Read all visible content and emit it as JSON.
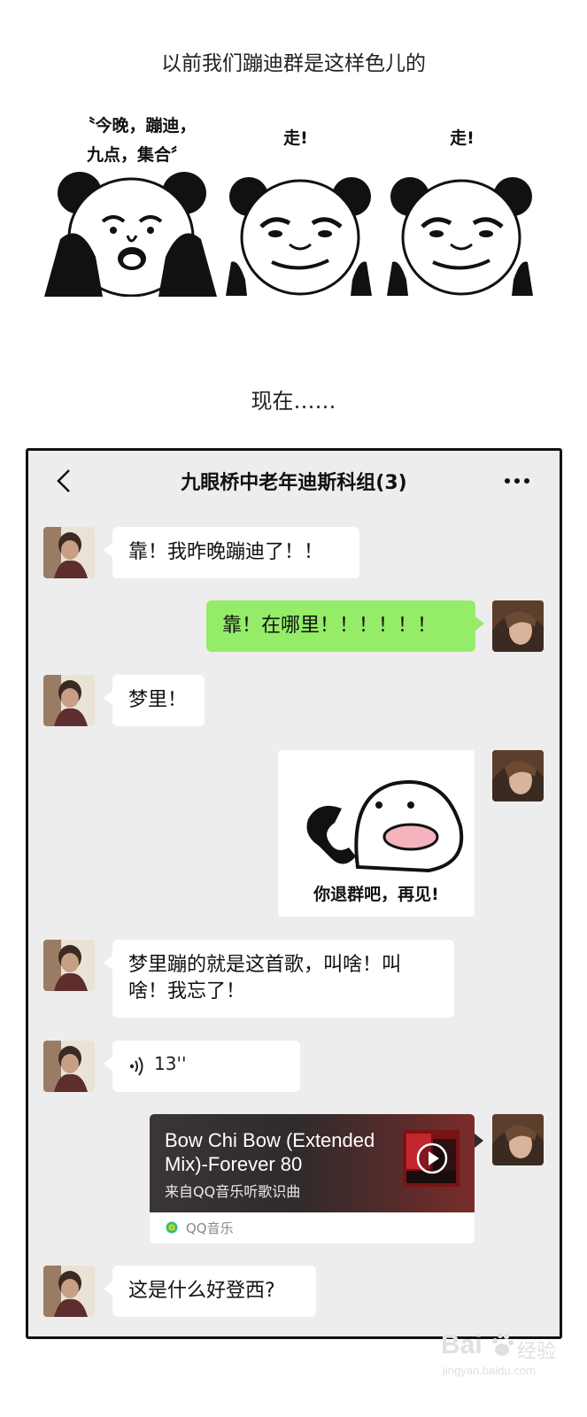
{
  "captions": {
    "top": "以前我们蹦迪群是这样色儿的",
    "now": "现在……"
  },
  "memes": [
    {
      "text_line1": "〝今晚，蹦迪，",
      "text_line2": "九点，集合〞"
    },
    {
      "text_line1": "走!",
      "text_line2": ""
    },
    {
      "text_line1": "走!",
      "text_line2": ""
    }
  ],
  "chat": {
    "title": "九眼桥中老年迪斯科组(3)",
    "messages": [
      {
        "from": "other",
        "text": "靠！我昨晚蹦迪了！！"
      },
      {
        "from": "me",
        "text": "靠！在哪里！！！！！！"
      },
      {
        "from": "other",
        "text": "梦里！"
      },
      {
        "from": "me",
        "type": "sticker",
        "text": "你退群吧，再见!"
      },
      {
        "from": "other",
        "text": "梦里蹦的就是这首歌，叫啥！叫啥！我忘了！"
      },
      {
        "from": "other",
        "type": "voice",
        "duration": "13''"
      },
      {
        "from": "me",
        "type": "music",
        "title": "Bow Chi Bow (Extended Mix)-Forever 80",
        "subtitle": "来自QQ音乐听歌识曲",
        "source": "QQ音乐"
      },
      {
        "from": "other",
        "text": "这是什么好登西?"
      }
    ]
  },
  "colors": {
    "chat_bg": "#ededed",
    "bubble_out": "#95ec69",
    "bubble_in": "#ffffff"
  },
  "watermark": {
    "brand": "Bai",
    "brand_cn": "经验",
    "url": "jingyan.baidu.com"
  }
}
